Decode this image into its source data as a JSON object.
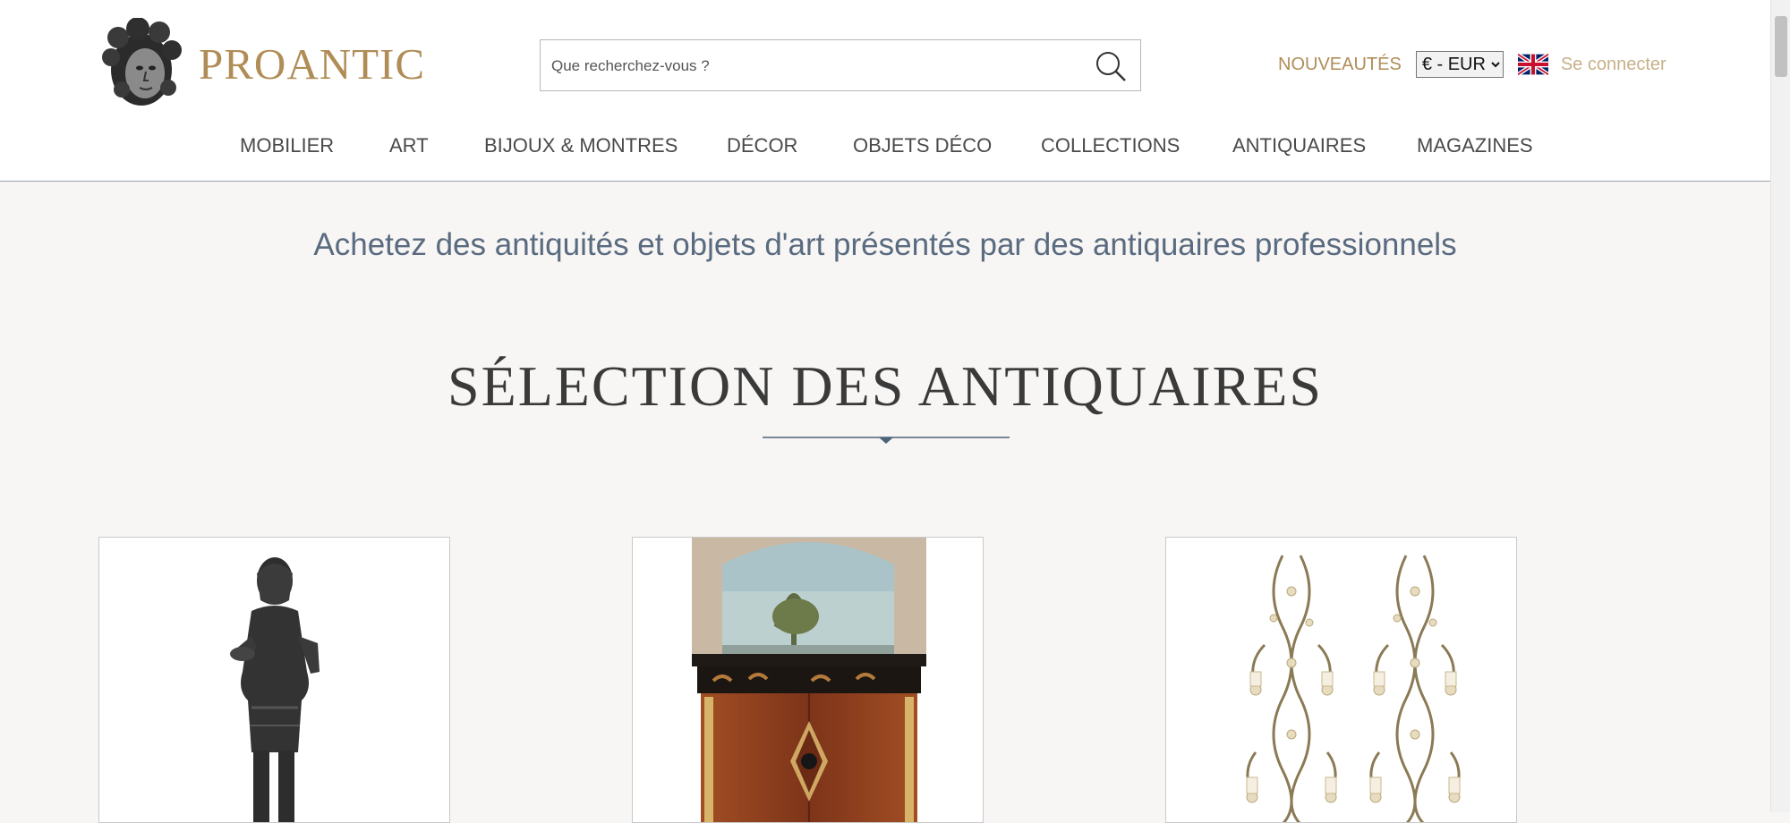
{
  "brand": {
    "name": "PROANTIC",
    "color": "#b08d57"
  },
  "search": {
    "placeholder": "Que recherchez-vous ?"
  },
  "top_links": {
    "new": "NOUVEAUTÉS",
    "currency_selected": "€ - EUR",
    "login": "Se connecter",
    "language_flag": "uk-flag-icon"
  },
  "nav": {
    "items": [
      "MOBILIER",
      "ART",
      "BIJOUX & MONTRES",
      "DÉCOR",
      "OBJETS DÉCO",
      "COLLECTIONS",
      "ANTIQUAIRES",
      "MAGAZINES"
    ]
  },
  "hero": {
    "tagline": "Achetez des antiquités et objets d'art présentés par des antiquaires professionnels",
    "section_title": "SÉLECTION DES ANTIQUAIRES"
  },
  "products": [
    {
      "image": "bronze-statue-figure"
    },
    {
      "image": "marquetry-cabinet-with-painted-screen"
    },
    {
      "image": "pair-of-crystal-wall-sconces"
    }
  ]
}
